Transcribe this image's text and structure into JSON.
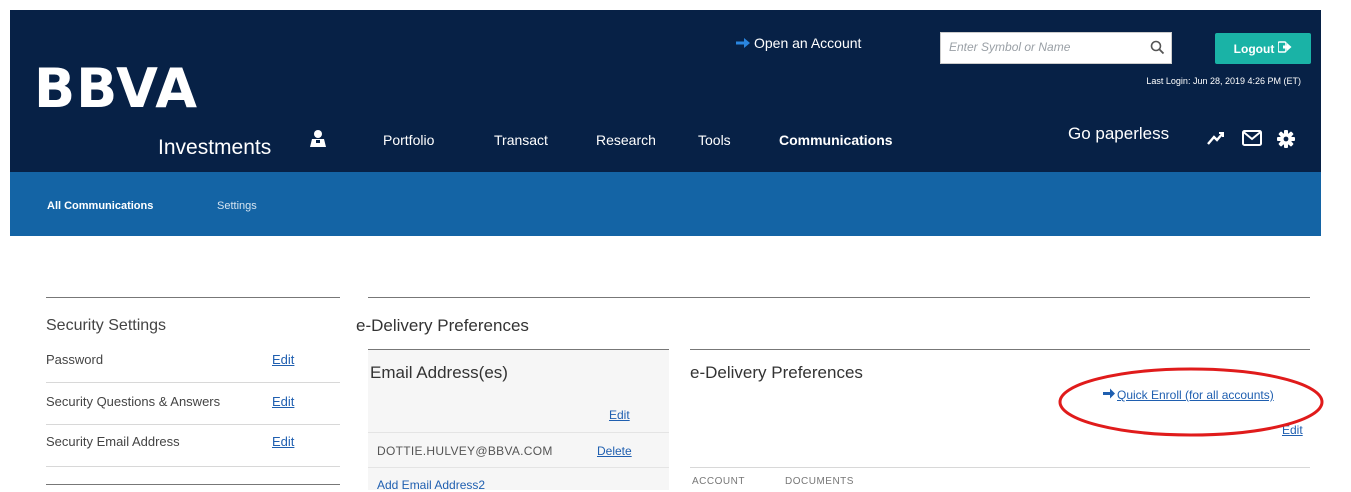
{
  "header": {
    "logo_text": "BBVA",
    "logo_sub": "Investments",
    "open_account": "Open an Account",
    "search_placeholder": "Enter Symbol or Name",
    "logout_label": "Logout",
    "last_login": "Last Login: Jun 28, 2019 4:26 PM (ET)",
    "go_paperless": "Go paperless",
    "nav": [
      "Portfolio",
      "Transact",
      "Research",
      "Tools",
      "Communications"
    ],
    "active_nav": "Communications",
    "icons": [
      "user-icon",
      "chart-check-icon",
      "mail-icon",
      "gear-icon",
      "search-icon",
      "logout-arrow-icon"
    ]
  },
  "subnav": {
    "items": [
      "All Communications",
      "Settings"
    ]
  },
  "security": {
    "title": "Security Settings",
    "rows": [
      {
        "label": "Password",
        "action": "Edit"
      },
      {
        "label": "Security Questions & Answers",
        "action": "Edit"
      },
      {
        "label": "Security Email Address",
        "action": "Edit"
      }
    ]
  },
  "delivery": {
    "title": "e-Delivery Preferences",
    "email_section": {
      "title": "Email Address(es)",
      "edit_label": "Edit",
      "email": "DOTTIE.HULVEY@BBVA.COM",
      "delete_label": "Delete",
      "add_label": "Add Email Address2"
    },
    "pref_section": {
      "title": "e-Delivery Preferences",
      "quick_enroll": "Quick Enroll (for all accounts)",
      "edit_label": "Edit",
      "columns": [
        "ACCOUNT",
        "DOCUMENTS"
      ]
    }
  },
  "colors": {
    "header_bg": "#072146",
    "subnav_bg": "#1464a5",
    "logout_bg": "#1ab3a6",
    "link": "#1f5fb0",
    "annotation": "#e01b1b"
  }
}
